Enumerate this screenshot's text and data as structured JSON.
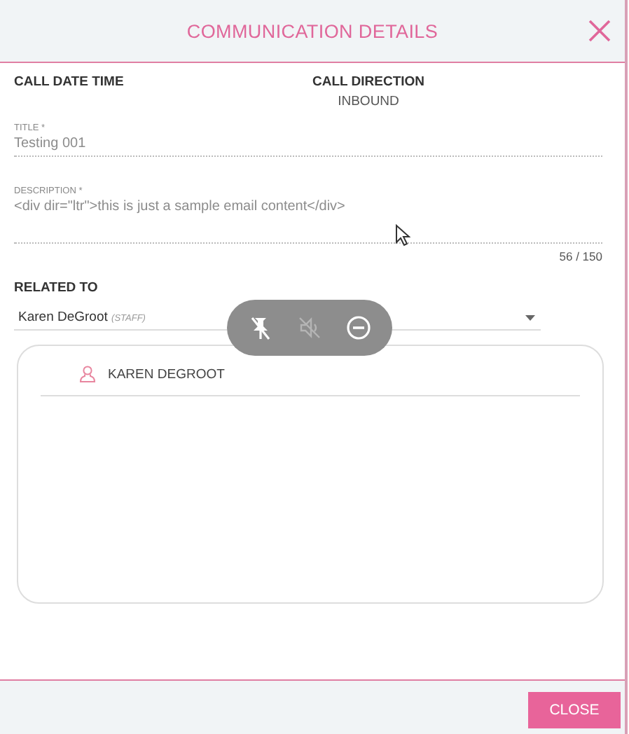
{
  "dialog": {
    "title": "COMMUNICATION DETAILS"
  },
  "info": [
    {
      "label": "CALL DATE TIME"
    },
    {
      "label": "CALL DIRECTION",
      "value": "INBOUND"
    }
  ],
  "fields": [
    {
      "label": "TITLE *",
      "value": "Testing 001"
    },
    {
      "label": "DESCRIPTION *",
      "value": "<div dir=\"ltr\">this is just a sample email content</div>",
      "counter": "56 / 150"
    }
  ],
  "related": {
    "label": "RELATED TO",
    "value": "Karen DeGroot",
    "tag": "(STAFF)",
    "items": [
      {
        "name": "KAREN DEGROOT"
      }
    ]
  },
  "overlay": {
    "buttons": [
      {
        "kind": "pin-off",
        "disabled": false
      },
      {
        "kind": "mute",
        "disabled": true
      },
      {
        "kind": "remove",
        "disabled": false
      }
    ]
  },
  "footer": {
    "buttons": [
      "CLOSE"
    ]
  }
}
